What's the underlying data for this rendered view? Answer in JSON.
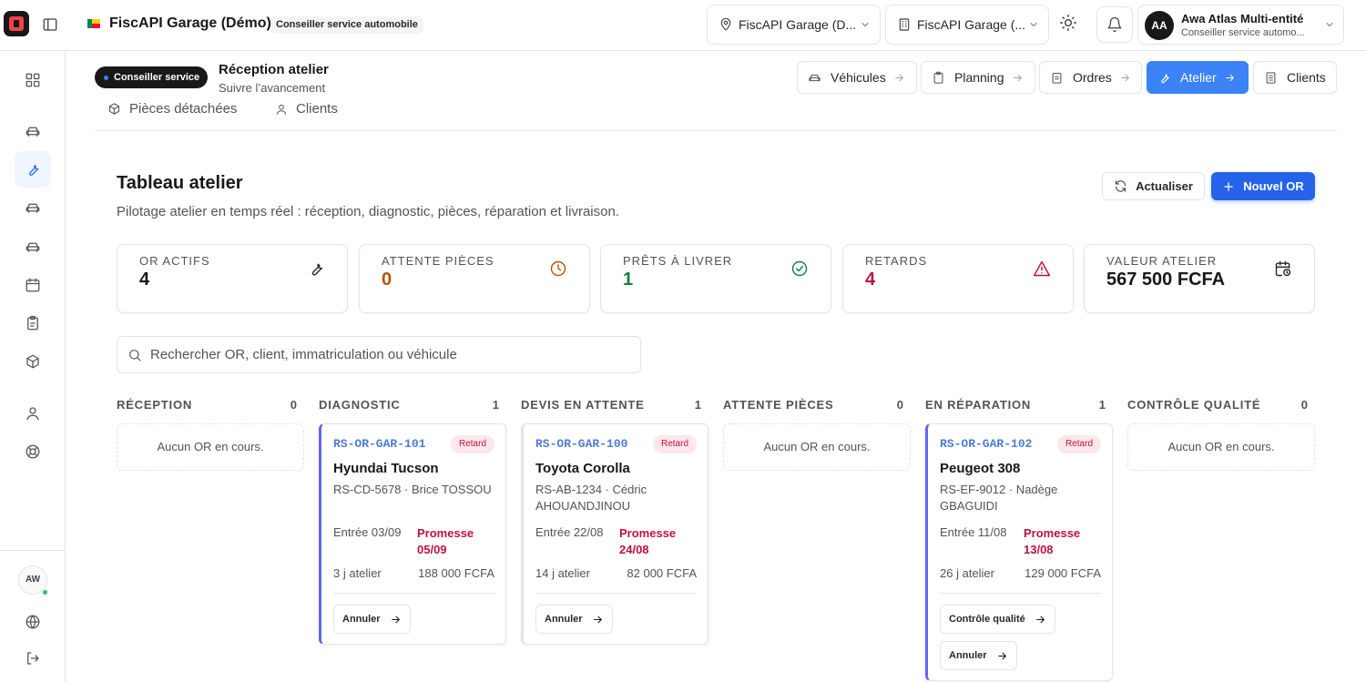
{
  "app": {
    "title": "FiscAPI Garage (Démo)",
    "role_pill": "Conseiller service automobile",
    "flag_colors": [
      "#008751",
      "#fcd116",
      "#e8112d"
    ]
  },
  "header": {
    "location_select": "FiscAPI Garage (D...",
    "company_select": "FiscAPI Garage (...",
    "user": {
      "initials": "AA",
      "name": "Awa Atlas Multi-entité",
      "role": "Conseiller service automo..."
    }
  },
  "rail": {
    "avatar_initials": "AW"
  },
  "section": {
    "pill": "Conseiller service",
    "title": "Réception atelier",
    "subtitle": "Suivre l’avancement",
    "nav_tabs": [
      {
        "label": "Véhicules"
      },
      {
        "label": "Planning"
      },
      {
        "label": "Ordres"
      },
      {
        "label": "Atelier"
      },
      {
        "label": "Clients"
      }
    ],
    "sub_tabs": [
      {
        "label": "Pièces détachées"
      },
      {
        "label": "Clients"
      }
    ]
  },
  "board": {
    "title": "Tableau atelier",
    "subtitle": "Pilotage atelier en temps réel : réception, diagnostic, pièces, réparation et livraison.",
    "refresh_label": "Actualiser",
    "new_label": "Nouvel OR"
  },
  "kpis": [
    {
      "label": "OR actifs",
      "value": "4",
      "color": "#18181b"
    },
    {
      "label": "Attente pièces",
      "value": "0",
      "color": "#b45309"
    },
    {
      "label": "Prêts à livrer",
      "value": "1",
      "color": "#15803d"
    },
    {
      "label": "Retards",
      "value": "4",
      "color": "#be123c"
    },
    {
      "label": "Valeur atelier",
      "value": "567 500 FCFA",
      "color": "#18181b"
    }
  ],
  "search": {
    "placeholder": "Rechercher OR, client, immatriculation ou véhicule"
  },
  "columns": [
    {
      "label": "Réception",
      "count": "0",
      "empty": "Aucun OR en cours."
    },
    {
      "label": "Diagnostic",
      "count": "1"
    },
    {
      "label": "Devis en attente",
      "count": "1"
    },
    {
      "label": "Attente pièces",
      "count": "0",
      "empty": "Aucun OR en cours."
    },
    {
      "label": "En réparation",
      "count": "1"
    },
    {
      "label": "Contrôle qualité",
      "count": "0",
      "empty": "Aucun OR en cours."
    }
  ],
  "cards": [
    {
      "ref": "RS-OR-GAR-101",
      "badge": "Retard",
      "vehicle": "Hyundai Tucson",
      "info": "RS-CD-5678 · Brice TOSSOU",
      "entry": "Entrée 03/09",
      "promise": "Promesse 05/09",
      "days": "3 j atelier",
      "amount": "188 000 FCFA",
      "actions": [
        "Annuler"
      ]
    },
    {
      "ref": "RS-OR-GAR-100",
      "badge": "Retard",
      "vehicle": "Toyota Corolla",
      "info": "RS-AB-1234 · Cédric AHOUANDJINOU",
      "entry": "Entrée 22/08",
      "promise": "Promesse 24/08",
      "days": "14 j atelier",
      "amount": "82 000 FCFA",
      "actions": [
        "Annuler"
      ]
    },
    {
      "ref": "RS-OR-GAR-102",
      "badge": "Retard",
      "vehicle": "Peugeot 308",
      "info": "RS-EF-9012 · Nadège GBAGUIDI",
      "entry": "Entrée 11/08",
      "promise": "Promesse 13/08",
      "days": "26 j atelier",
      "amount": "129 000 FCFA",
      "actions": [
        "Contrôle qualité",
        "Annuler"
      ]
    }
  ]
}
